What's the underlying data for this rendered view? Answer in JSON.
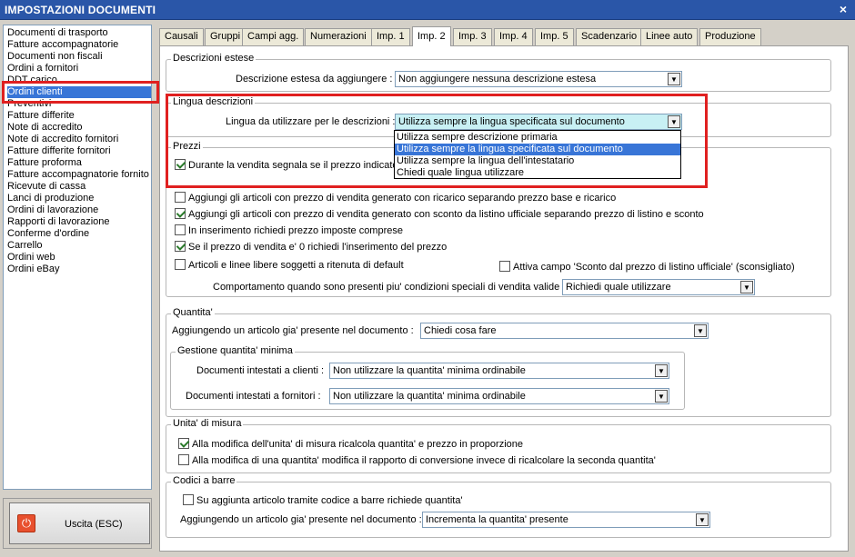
{
  "window": {
    "title": "IMPOSTAZIONI DOCUMENTI",
    "close_glyph": "×"
  },
  "sidebar": {
    "items": [
      "Documenti di trasporto",
      "Fatture accompagnatorie",
      "Documenti non fiscali",
      "Ordini a fornitori",
      "DDT carico",
      "Ordini clienti",
      "Preventivi",
      "Fatture differite",
      "Note di accredito",
      "Note di accredito fornitori",
      "Fatture differite fornitori",
      "Fatture proforma",
      "Fatture accompagnatorie fornito",
      "Ricevute di cassa",
      "Lanci di produzione",
      "Ordini di lavorazione",
      "Rapporti di lavorazione",
      "Conferme d'ordine",
      "Carrello",
      "Ordini web",
      "Ordini eBay"
    ],
    "selected": "Ordini clienti"
  },
  "exit": {
    "label": "Uscita (ESC)",
    "icon": "power-icon"
  },
  "tabs": [
    "Causali",
    "Gruppi",
    "Campi agg.",
    "Numerazioni",
    "Imp. 1",
    "Imp. 2",
    "Imp. 3",
    "Imp. 4",
    "Imp. 5",
    "Scadenzario",
    "Linee auto",
    "Produzione"
  ],
  "active_tab": "Imp. 2",
  "descrizioni_estese": {
    "title": "Descrizioni estese",
    "label": "Descrizione estesa da aggiungere :",
    "value": "Non aggiungere nessuna descrizione estesa"
  },
  "lingua": {
    "title": "Lingua descrizioni",
    "label": "Lingua da utilizzare per le descrizioni :",
    "value": "Utilizza sempre la lingua specificata sul documento",
    "options": [
      "Utilizza sempre descrizione primaria",
      "Utilizza sempre la lingua specificata sul documento",
      "Utilizza sempre la lingua dell'intestatario",
      "Chiedi quale lingua utilizzare"
    ]
  },
  "prezzi": {
    "title": "Prezzi",
    "vendita_segnala": "Durante la vendita segnala se il prezzo indicato",
    "checks": [
      {
        "label": "Aggiungi gli articoli con prezzo di vendita generato con ricarico separando prezzo base e ricarico",
        "checked": false
      },
      {
        "label": "Aggiungi gli articoli con prezzo di vendita generato con sconto da listino ufficiale separando prezzo di listino e sconto",
        "checked": true
      },
      {
        "label": "In inserimento richiedi prezzo imposte comprese",
        "checked": false
      },
      {
        "label": "Se il prezzo di vendita e' 0 richiedi l'inserimento del prezzo",
        "checked": true
      },
      {
        "label": "Articoli e linee libere soggetti a ritenuta di default",
        "checked": false
      }
    ],
    "sconto_check": {
      "label": "Attiva campo 'Sconto dal prezzo di listino ufficiale' (sconsigliato)",
      "checked": false
    },
    "comportamento_label": "Comportamento quando sono presenti piu' condizioni speciali di vendita valide :",
    "comportamento_value": "Richiedi quale utilizzare"
  },
  "quantita": {
    "title": "Quantita'",
    "label": "Aggiungendo un articolo gia' presente nel documento :",
    "value": "Chiedi cosa fare",
    "minima": {
      "title": "Gestione quantita' minima",
      "clienti_label": "Documenti intestati a clienti :",
      "clienti_value": "Non utilizzare la quantita' minima ordinabile",
      "fornitori_label": "Documenti intestati a fornitori :",
      "fornitori_value": "Non utilizzare la quantita' minima ordinabile"
    }
  },
  "unita": {
    "title": "Unita' di misura",
    "checks": [
      {
        "label": "Alla modifica dell'unita' di misura ricalcola quantita' e prezzo in proporzione",
        "checked": true
      },
      {
        "label": "Alla modifica di una quantita' modifica il rapporto di conversione invece di ricalcolare la seconda quantita'",
        "checked": false
      }
    ]
  },
  "codici": {
    "title": "Codici a barre",
    "check": {
      "label": "Su aggiunta articolo tramite codice a barre richiede quantita'",
      "checked": false
    },
    "label": "Aggiungendo un articolo gia' presente nel documento :",
    "value": "Incrementa la quantita' presente"
  }
}
